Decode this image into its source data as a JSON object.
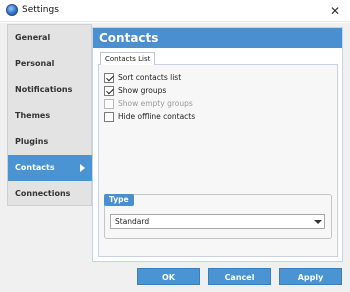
{
  "window": {
    "title": "Settings",
    "close_glyph": "✕"
  },
  "sidebar": {
    "items": [
      {
        "label": "General"
      },
      {
        "label": "Personal"
      },
      {
        "label": "Notifications"
      },
      {
        "label": "Themes"
      },
      {
        "label": "Plugins"
      },
      {
        "label": "Contacts",
        "active": true
      },
      {
        "label": "Connections"
      }
    ]
  },
  "content": {
    "header": "Contacts",
    "tab": "Contacts List",
    "options": [
      {
        "label": "Sort contacts list",
        "checked": true,
        "disabled": false
      },
      {
        "label": "Show groups",
        "checked": true,
        "disabled": false
      },
      {
        "label": "Show empty groups",
        "checked": false,
        "disabled": true
      },
      {
        "label": "Hide offline contacts",
        "checked": false,
        "disabled": false
      }
    ],
    "type_group": {
      "legend": "Type",
      "selected": "Standard"
    }
  },
  "buttons": {
    "ok": "OK",
    "cancel": "Cancel",
    "apply": "Apply"
  },
  "colors": {
    "accent": "#4a8fd0",
    "sidebar_active": "#4a94d3"
  }
}
